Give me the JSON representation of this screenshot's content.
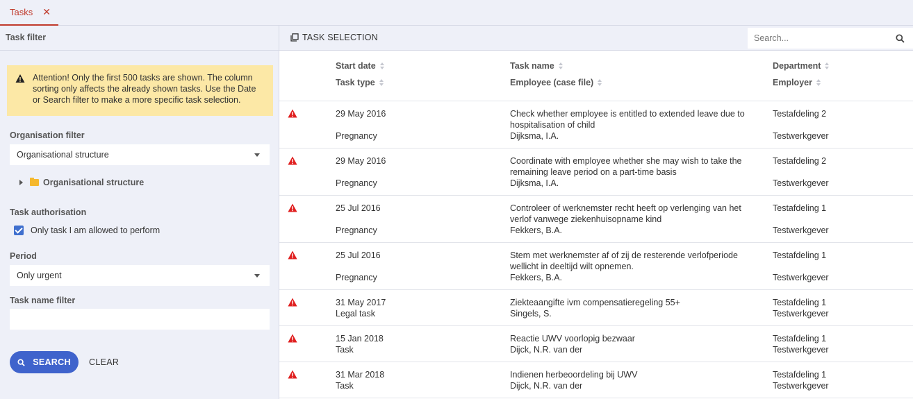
{
  "tabs": [
    {
      "label": "Tasks"
    }
  ],
  "left_panel": {
    "title": "Task filter",
    "alert": "Attention! Only the first 500 tasks are shown. The column sorting only affects the already shown tasks. Use the Date or Search filter to make a more specific task selection.",
    "organisation_filter": {
      "label": "Organisation filter",
      "selected": "Organisational structure",
      "tree_node": "Organisational structure"
    },
    "task_authorisation": {
      "label": "Task authorisation",
      "checkbox_label": "Only task I am allowed to perform",
      "checked": true
    },
    "period": {
      "label": "Period",
      "selected": "Only urgent"
    },
    "task_name_filter": {
      "label": "Task name filter",
      "value": ""
    },
    "search_button": "SEARCH",
    "clear_button": "CLEAR"
  },
  "right_panel": {
    "toolbar_label": "TASK SELECTION",
    "search_placeholder": "Search...",
    "columns": {
      "start_date": "Start date",
      "task_type": "Task type",
      "task_name": "Task name",
      "employee": "Employee (case file)",
      "department": "Department",
      "employer": "Employer"
    },
    "rows": [
      {
        "start_date": "29 May 2016",
        "task_type": "Pregnancy",
        "task_name": "Check whether employee is entitled to extended leave due to hospitalisation of child",
        "employee": "Dijksma, I.A.",
        "department": "Testafdeling 2",
        "employer": "Testwerkgever"
      },
      {
        "start_date": "29 May 2016",
        "task_type": "Pregnancy",
        "task_name": "Coordinate with employee whether she may wish to take the remaining leave period on a part-time basis",
        "employee": "Dijksma, I.A.",
        "department": "Testafdeling 2",
        "employer": "Testwerkgever"
      },
      {
        "start_date": "25 Jul 2016",
        "task_type": "Pregnancy",
        "task_name": "Controleer of werknemster recht heeft op verlenging van het verlof vanwege ziekenhuisopname kind",
        "employee": "Fekkers, B.A.",
        "department": "Testafdeling 1",
        "employer": "Testwerkgever"
      },
      {
        "start_date": "25 Jul 2016",
        "task_type": "Pregnancy",
        "task_name": "Stem met werknemster af of zij de resterende verlofperiode wellicht in deeltijd wilt opnemen.",
        "employee": "Fekkers, B.A.",
        "department": "Testafdeling 1",
        "employer": "Testwerkgever"
      },
      {
        "start_date": "31 May 2017",
        "task_type": "Legal task",
        "task_name": "Ziekteaangifte ivm compensatieregeling 55+",
        "employee": "Singels, S.",
        "department": "Testafdeling 1",
        "employer": "Testwerkgever"
      },
      {
        "start_date": "15 Jan 2018",
        "task_type": "Task",
        "task_name": "Reactie UWV voorlopig bezwaar",
        "employee": "Dijck, N.R. van der",
        "department": "Testafdeling 1",
        "employer": "Testwerkgever"
      },
      {
        "start_date": "31 Mar 2018",
        "task_type": "Task",
        "task_name": "Indienen herbeoordeling bij UWV",
        "employee": "Dijck, N.R. van der",
        "department": "Testafdeling 1",
        "employer": "Testwerkgever"
      }
    ]
  },
  "colors": {
    "accent_red": "#c0392b",
    "primary_blue": "#3f63cc",
    "alert_bg": "#fce8a6",
    "warning_icon": "#e02020"
  },
  "icons": {
    "tab_close": "close-icon",
    "alert": "warning-icon",
    "row_status": "urgent-warning-icon",
    "search": "search-icon",
    "task_selection": "copy-icon",
    "folder": "folder-icon"
  }
}
